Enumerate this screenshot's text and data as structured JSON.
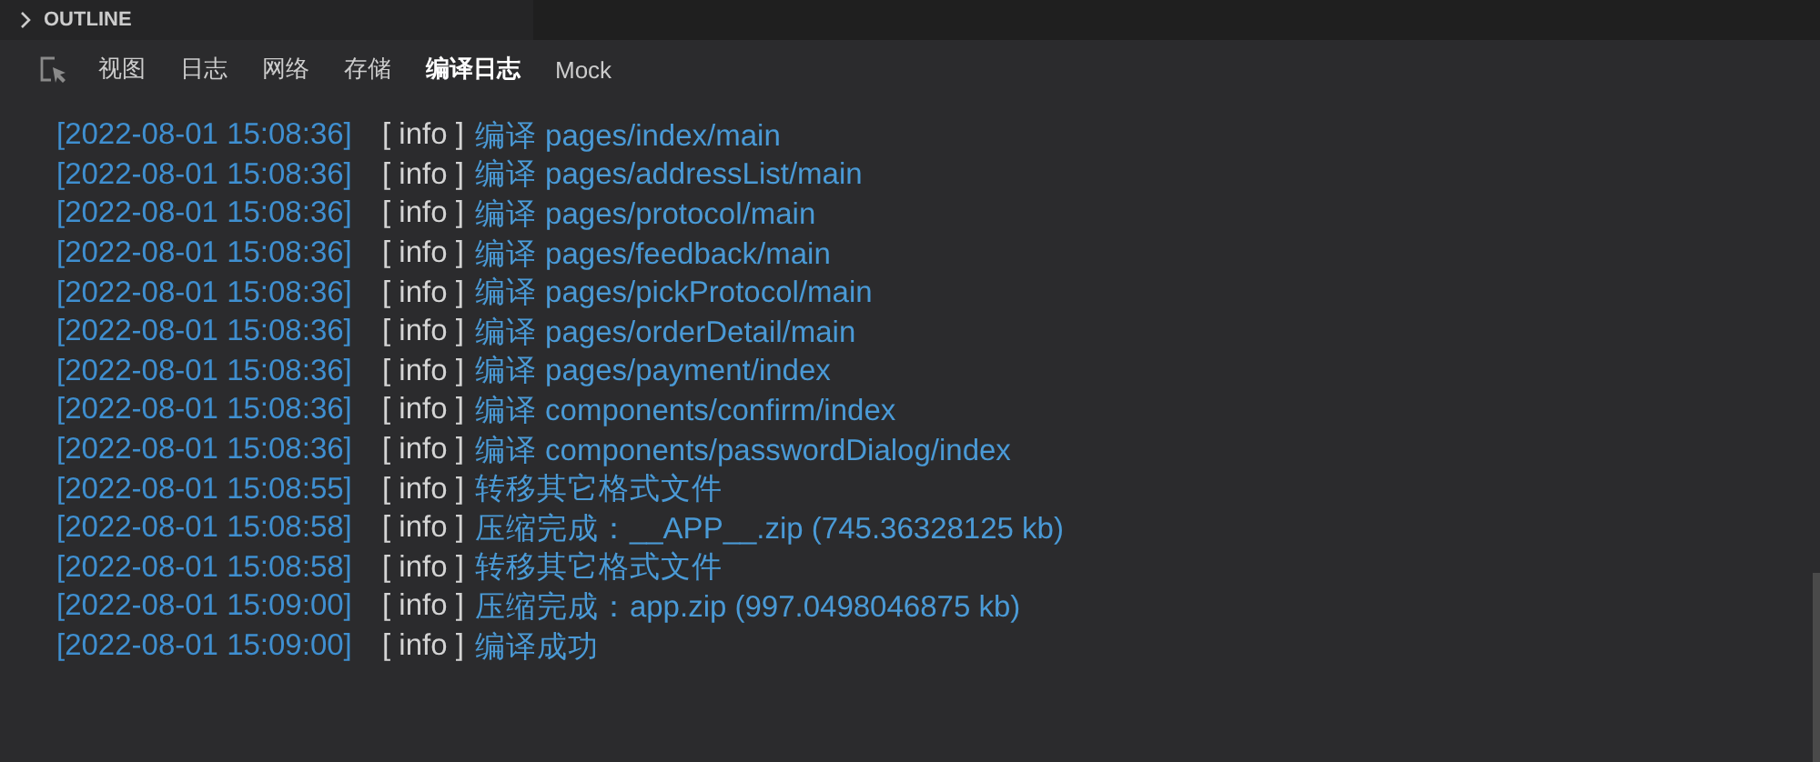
{
  "header": {
    "title": "OUTLINE",
    "expanded": false
  },
  "tabs": [
    {
      "label": "视图",
      "selected": false
    },
    {
      "label": "日志",
      "selected": false
    },
    {
      "label": "网络",
      "selected": false
    },
    {
      "label": "存储",
      "selected": false
    },
    {
      "label": "编译日志",
      "selected": true
    },
    {
      "label": "Mock",
      "selected": false
    }
  ],
  "log": [
    {
      "time": "[2022-08-01 15:08:36]",
      "level": "[ info ]",
      "message": "编译 pages/index/main"
    },
    {
      "time": "[2022-08-01 15:08:36]",
      "level": "[ info ]",
      "message": "编译 pages/addressList/main"
    },
    {
      "time": "[2022-08-01 15:08:36]",
      "level": "[ info ]",
      "message": "编译 pages/protocol/main"
    },
    {
      "time": "[2022-08-01 15:08:36]",
      "level": "[ info ]",
      "message": "编译 pages/feedback/main"
    },
    {
      "time": "[2022-08-01 15:08:36]",
      "level": "[ info ]",
      "message": "编译 pages/pickProtocol/main"
    },
    {
      "time": "[2022-08-01 15:08:36]",
      "level": "[ info ]",
      "message": "编译 pages/orderDetail/main"
    },
    {
      "time": "[2022-08-01 15:08:36]",
      "level": "[ info ]",
      "message": "编译 pages/payment/index"
    },
    {
      "time": "[2022-08-01 15:08:36]",
      "level": "[ info ]",
      "message": "编译 components/confirm/index"
    },
    {
      "time": "[2022-08-01 15:08:36]",
      "level": "[ info ]",
      "message": "编译 components/passwordDialog/index"
    },
    {
      "time": "[2022-08-01 15:08:55]",
      "level": "[ info ]",
      "message": "转移其它格式文件"
    },
    {
      "time": "[2022-08-01 15:08:58]",
      "level": "[ info ]",
      "message": "压缩完成：__APP__.zip (745.36328125 kb)"
    },
    {
      "time": "[2022-08-01 15:08:58]",
      "level": "[ info ]",
      "message": "转移其它格式文件"
    },
    {
      "time": "[2022-08-01 15:09:00]",
      "level": "[ info ]",
      "message": "压缩完成：app.zip (997.0498046875 kb)"
    },
    {
      "time": "[2022-08-01 15:09:00]",
      "level": "[ info ]",
      "message": "编译成功"
    }
  ]
}
